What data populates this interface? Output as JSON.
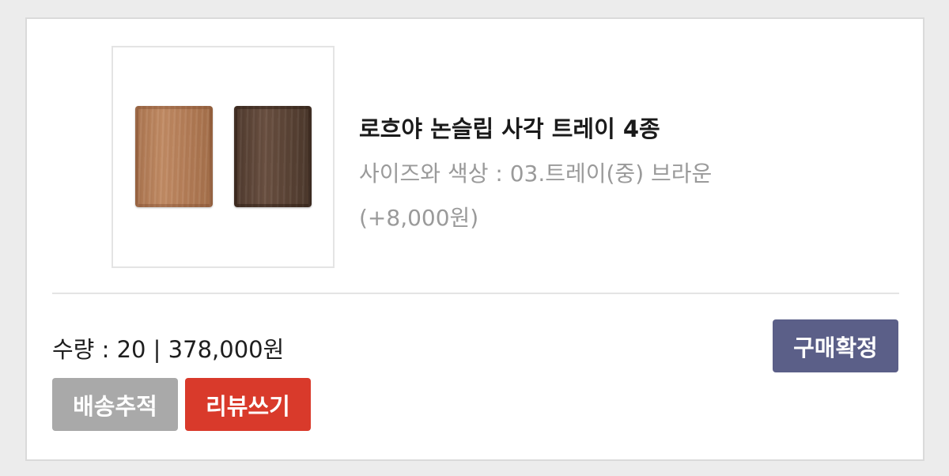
{
  "order": {
    "product": {
      "image_icon": "wooden-tray-product-image",
      "title": "로흐야 논슬립 사각 트레이 4종",
      "option": "사이즈와 색상 : 03.트레이(중) 브라운",
      "option_price": "(+8,000원)"
    },
    "summary": "수량 : 20 | 378,000원",
    "buttons": {
      "confirm_purchase": "구매확정",
      "track_delivery": "배송추적",
      "write_review": "리뷰쓰기"
    },
    "colors": {
      "confirm": "#5b5f88",
      "track": "#a9a9a9",
      "review": "#d93a2b",
      "title_text": "#1a1a1a",
      "option_text": "#9a9a9a"
    }
  }
}
